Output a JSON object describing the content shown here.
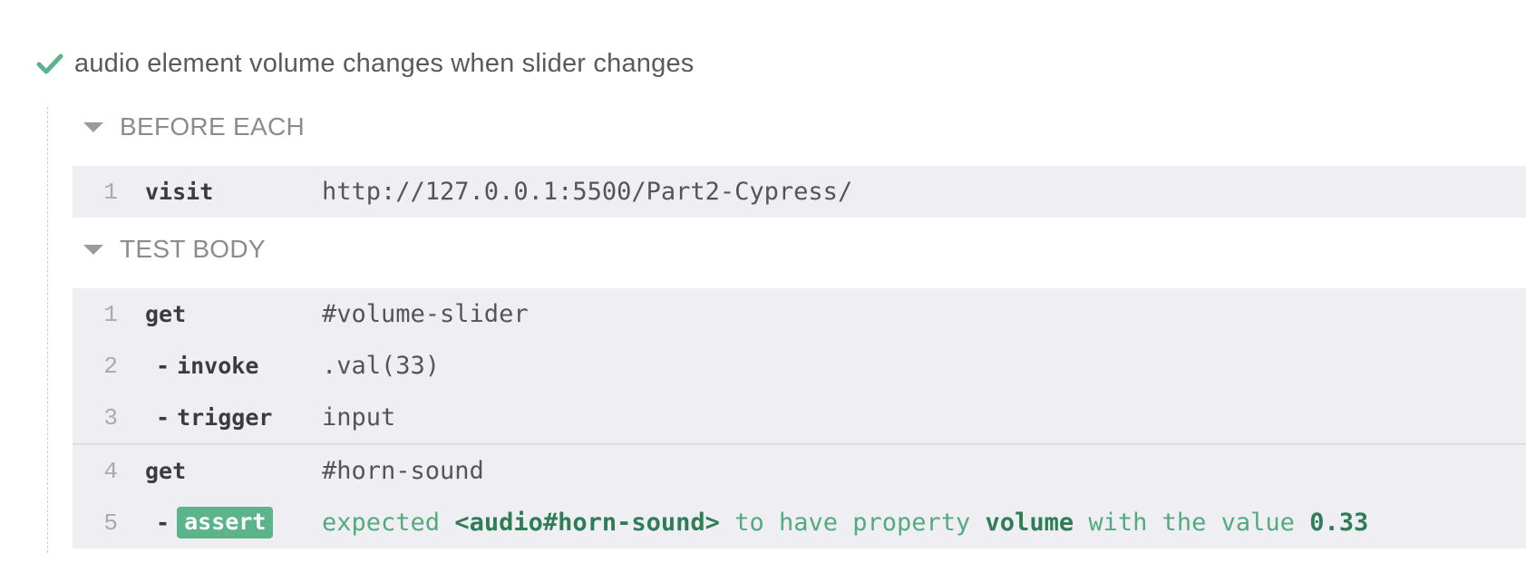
{
  "test": {
    "title": "audio element volume changes when slider changes",
    "status_icon": "check-icon",
    "status_color": "#5bb48a"
  },
  "before_each": {
    "label": "BEFORE EACH",
    "commands": [
      {
        "num": "1",
        "name": "visit",
        "message": "http://127.0.0.1:5500/Part2-Cypress/"
      }
    ]
  },
  "test_body": {
    "label": "TEST BODY",
    "commands": [
      {
        "num": "1",
        "name": "get",
        "message": "#volume-slider"
      },
      {
        "num": "2",
        "dash": "-",
        "name": "invoke",
        "message": ".val(33)"
      },
      {
        "num": "3",
        "dash": "-",
        "name": "trigger",
        "message": "input"
      },
      {
        "num": "4",
        "name": "get",
        "message": "#horn-sound"
      },
      {
        "num": "5",
        "dash": "-",
        "name": "assert",
        "message_parts": {
          "p1": "expected",
          "subject": "<audio#horn-sound>",
          "p2": "to have property",
          "property": "volume",
          "p3": "with the value",
          "value": "0.33"
        }
      }
    ]
  }
}
